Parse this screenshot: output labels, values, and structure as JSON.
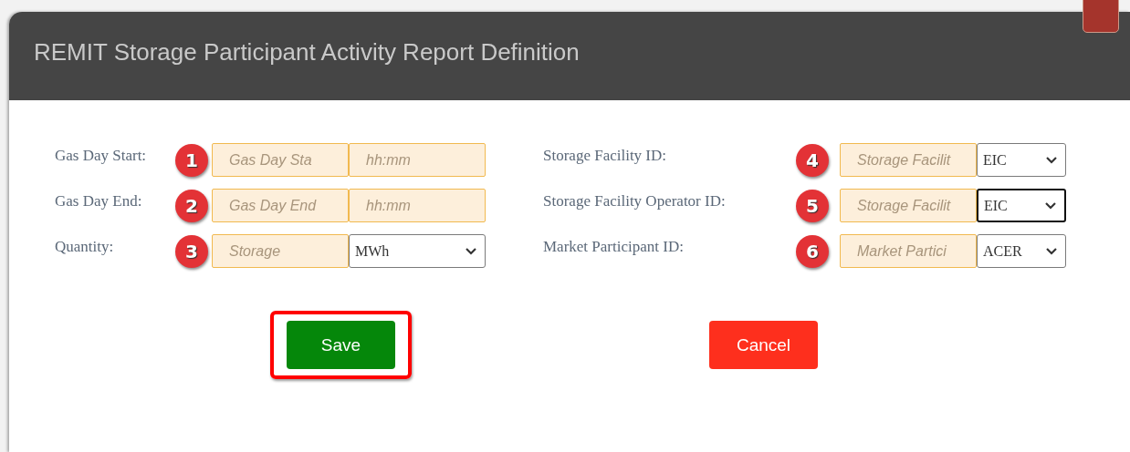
{
  "dialog": {
    "title": "REMIT Storage Participant Activity Report Definition"
  },
  "left_rows": [
    {
      "label": "Gas Day Start:",
      "badge": "1",
      "fields": [
        {
          "kind": "input",
          "placeholder": "Gas Day Sta"
        },
        {
          "kind": "input",
          "placeholder": "hh:mm"
        }
      ]
    },
    {
      "label": "Gas Day End:",
      "badge": "2",
      "fields": [
        {
          "kind": "input",
          "placeholder": "Gas Day End"
        },
        {
          "kind": "input",
          "placeholder": "hh:mm"
        }
      ]
    },
    {
      "label": "Quantity:",
      "badge": "3",
      "fields": [
        {
          "kind": "input",
          "placeholder": "Storage"
        },
        {
          "kind": "select",
          "value": "MWh",
          "focused": false
        }
      ]
    }
  ],
  "right_rows": [
    {
      "label": "Storage Facility ID:",
      "badge": "4",
      "fields": [
        {
          "kind": "input",
          "placeholder": "Storage Facilit"
        },
        {
          "kind": "select",
          "value": "EIC",
          "focused": false
        }
      ]
    },
    {
      "label": "Storage Facility Operator ID:",
      "badge": "5",
      "fields": [
        {
          "kind": "input",
          "placeholder": "Storage Facilit"
        },
        {
          "kind": "select",
          "value": "EIC",
          "focused": true
        }
      ]
    },
    {
      "label": "Market Participant ID:",
      "badge": "6",
      "fields": [
        {
          "kind": "input",
          "placeholder": "Market Partici"
        },
        {
          "kind": "select",
          "value": "ACER",
          "focused": false
        }
      ]
    }
  ],
  "buttons": [
    {
      "kind": "save",
      "label": "Save",
      "highlighted": true
    },
    {
      "kind": "cancel",
      "label": "Cancel",
      "highlighted": false
    }
  ]
}
